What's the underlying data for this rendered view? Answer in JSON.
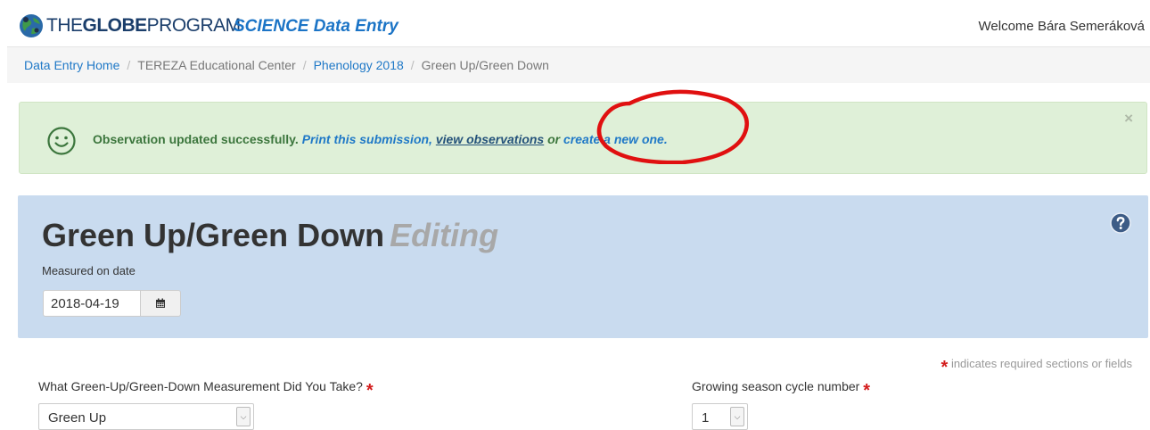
{
  "header": {
    "logo_text_the": "THE",
    "logo_text_globe": "GLOBE",
    "logo_text_program": "PROGRAM",
    "app_title": "SCIENCE Data Entry",
    "welcome": "Welcome Bára Semeráková"
  },
  "breadcrumb": {
    "items": [
      "Data Entry Home",
      "TEREZA Educational Center",
      "Phenology 2018",
      "Green Up/Green Down"
    ],
    "separator": "/"
  },
  "alert": {
    "message": "Observation updated successfully.",
    "print_link": "Print this submission,",
    "view_link": "view observations",
    "or_text": "or",
    "create_link": "create a new one.",
    "close": "×"
  },
  "panel": {
    "title": "Green Up/Green Down",
    "status": "Editing",
    "date_label": "Measured on date",
    "date_value": "2018-04-19"
  },
  "form": {
    "required_star": "*",
    "required_note": "indicates required sections or fields",
    "q1_label": "What Green-Up/Green-Down Measurement Did You Take?",
    "q1_value": "Green Up",
    "q2_label": "Growing season cycle number",
    "q2_value": "1"
  },
  "colors": {
    "brand_blue": "#1b74c6",
    "link": "#2079c7",
    "alert_bg": "#dff0d8",
    "alert_text": "#3c763d",
    "panel_bg": "#c9dbef",
    "annotation_red": "#e01010"
  }
}
